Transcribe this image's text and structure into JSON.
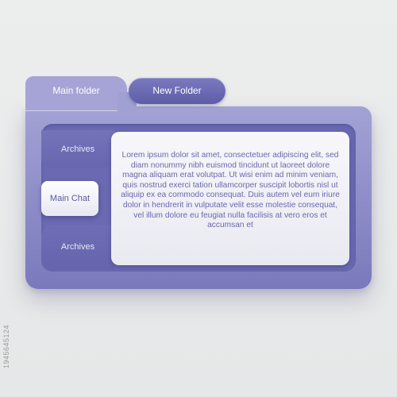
{
  "folder": {
    "main_tab_label": "Main folder",
    "new_folder_label": "New Folder"
  },
  "sidebar": {
    "items": [
      {
        "label": "Archives"
      },
      {
        "label": "Main Chat",
        "active": true
      },
      {
        "label": "Archives"
      }
    ]
  },
  "content": {
    "text": "Lorem ipsum dolor sit amet, consectetuer adipiscing elit, sed diam nonummy nibh euismod tincidunt ut laoreet dolore magna aliquam erat volutpat. Ut wisi enim ad minim veniam, quis nostrud exerci tation ullamcorper suscipit lobortis nisl ut aliquip ex ea commodo consequat. Duis autem vel eum iriure dolor in hendrerit in vulputate velit esse molestie consequat, vel illum dolore eu feugiat nulla facilisis at vero eros et accumsan et"
  },
  "stock_id": "1945645124",
  "colors": {
    "background": "#e9eaeb",
    "folder_light": "#a6a4d6",
    "folder_dark": "#6a69b2",
    "accent": "#5d5ca6",
    "panel": "#f7f7fb",
    "text": "#6a69ad"
  }
}
